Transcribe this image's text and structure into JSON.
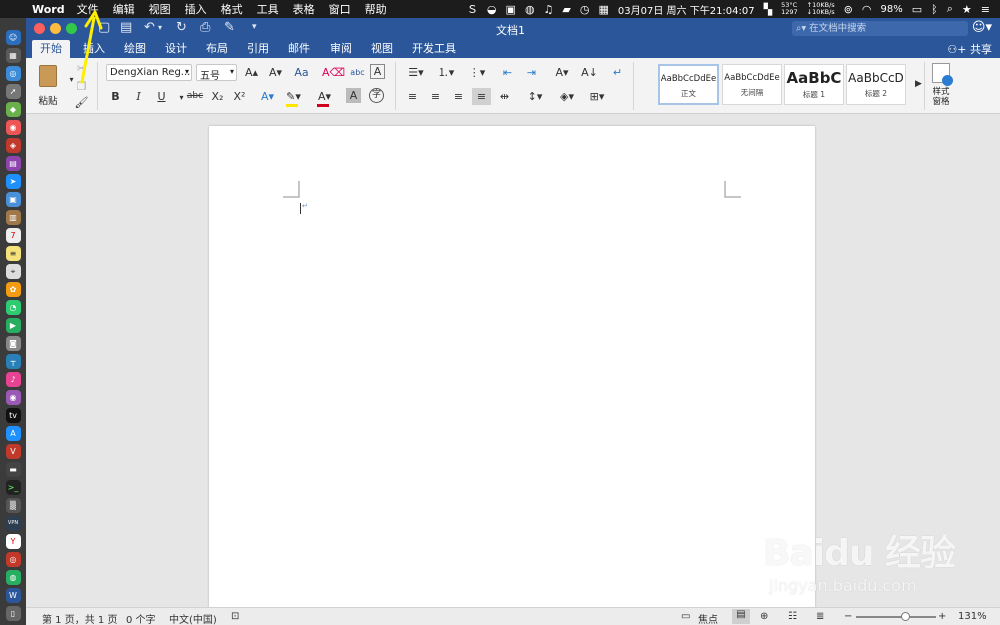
{
  "menubar": {
    "app_name": "Word",
    "items": [
      "文件",
      "编辑",
      "视图",
      "插入",
      "格式",
      "工具",
      "表格",
      "窗口",
      "帮助"
    ],
    "datetime": "03月07日 周六 下午21:04:07",
    "temp": "53°C",
    "fan": "1297",
    "net_up": "↑10KB/s",
    "net_down": "↓10KB/s",
    "battery": "98%"
  },
  "window": {
    "title": "文档1",
    "search_placeholder": "在文档中搜索",
    "share_label": "共享",
    "tabs": [
      "开始",
      "插入",
      "绘图",
      "设计",
      "布局",
      "引用",
      "邮件",
      "审阅",
      "视图",
      "开发工具"
    ]
  },
  "ribbon": {
    "paste_label": "粘贴",
    "font_name": "DengXian Reg...",
    "font_size": "五号",
    "styles": [
      {
        "sample": "AaBbCcDdEe",
        "name": "正文"
      },
      {
        "sample": "AaBbCcDdEe",
        "name": "无间隔"
      },
      {
        "sample": "AaBbC",
        "name": "标题 1"
      },
      {
        "sample": "AaBbCcD",
        "name": "标题 2"
      }
    ],
    "styles_pane_label": "样式\n窗格"
  },
  "statusbar": {
    "page": "第 1 页，共 1 页",
    "words": "0 个字",
    "language": "中文(中国)",
    "focus": "焦点",
    "zoom": "131%",
    "zoom_level": 0.62
  },
  "watermark": {
    "brand": "Baidu 经验",
    "url": "jingyan.baidu.com"
  },
  "colors": {
    "accent": "#2b579a",
    "font_color": "#d0021b",
    "highlight": "#ffe600",
    "annotation": "#ffee00"
  }
}
